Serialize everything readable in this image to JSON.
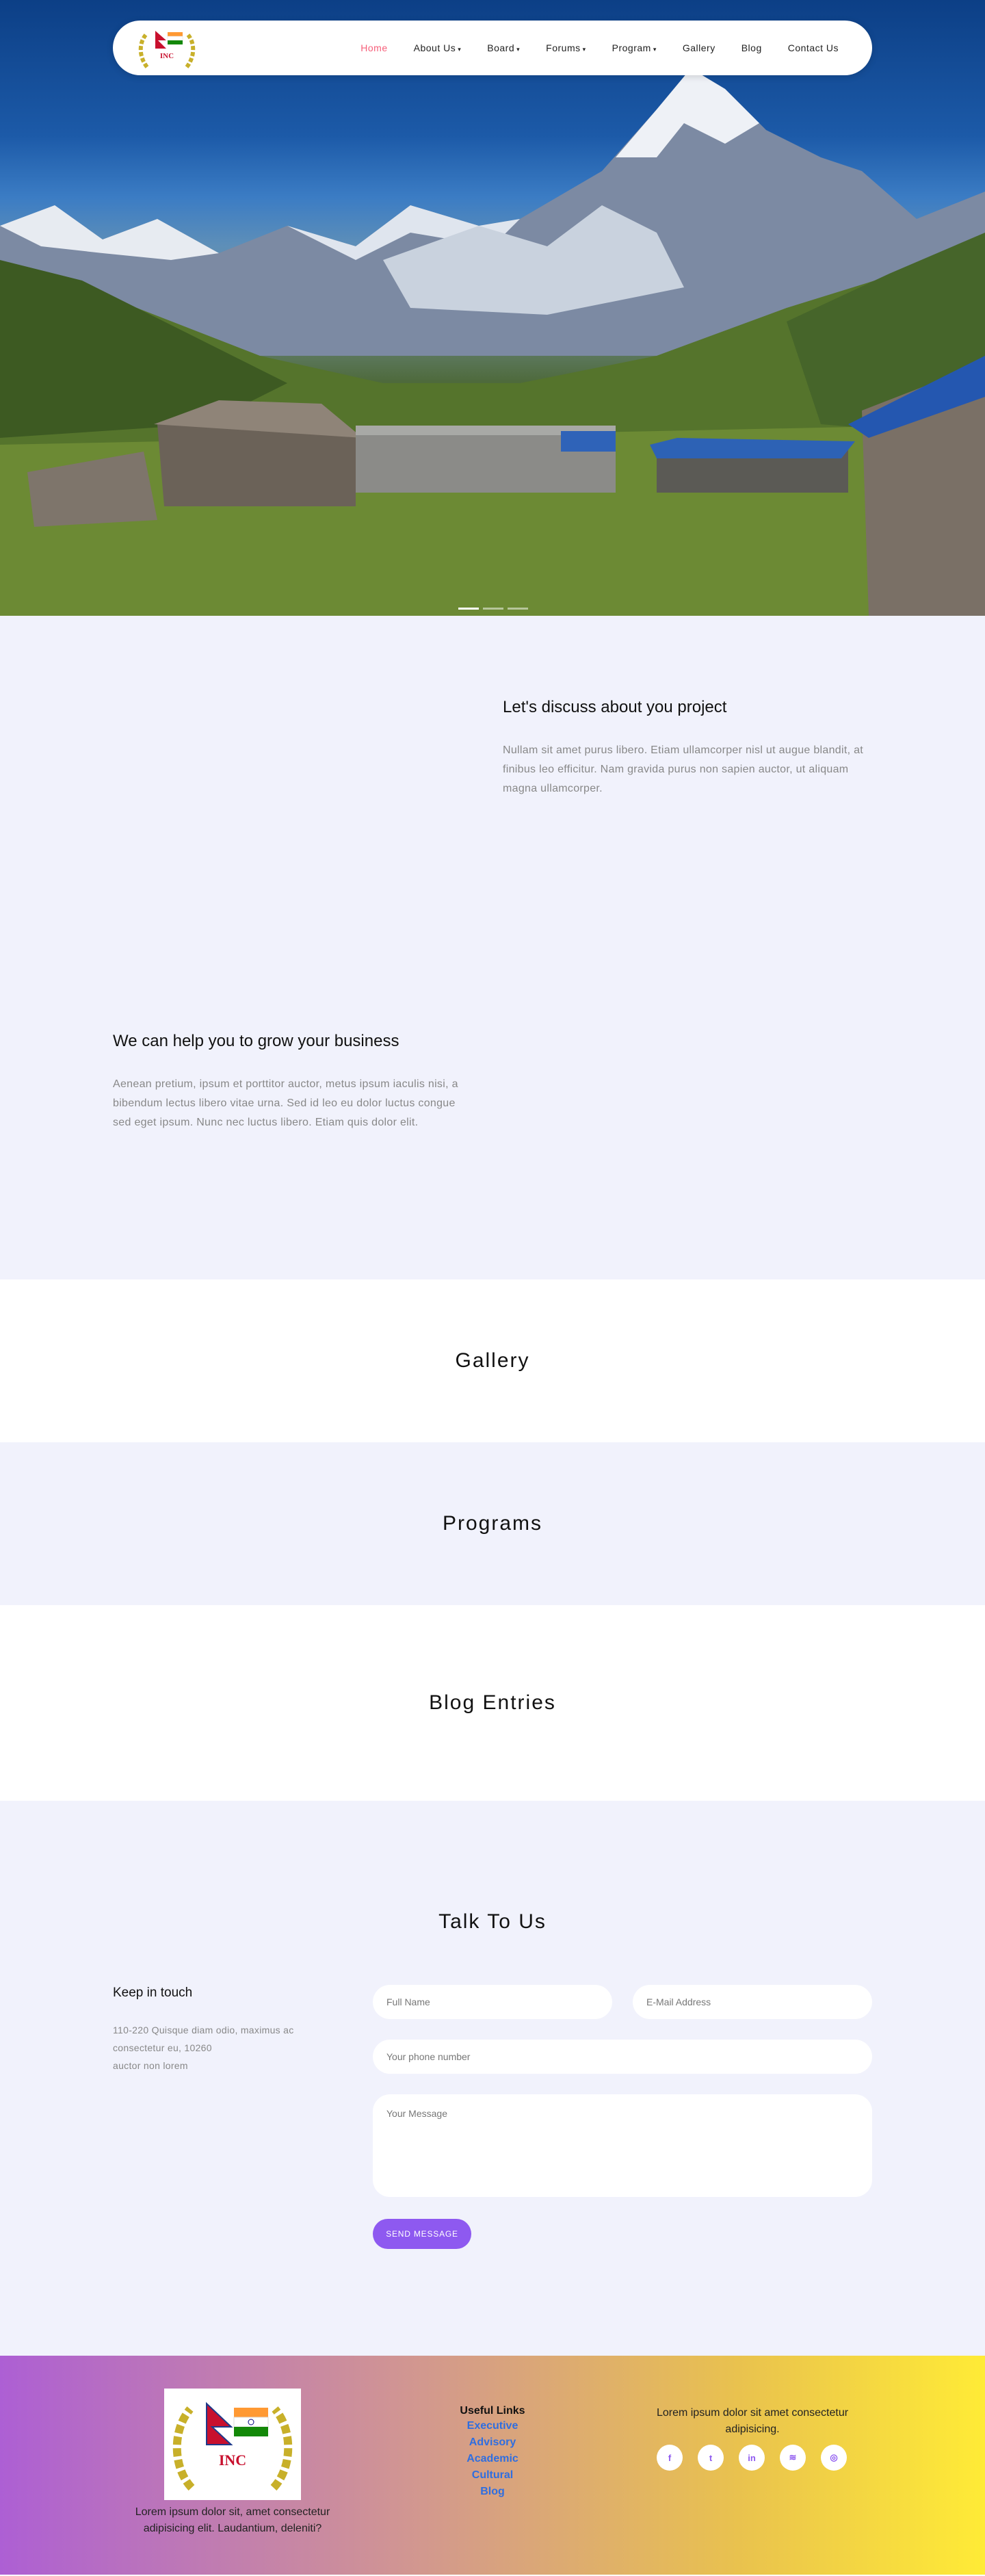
{
  "nav": {
    "items": [
      {
        "label": "Home",
        "active": true,
        "dropdown": false
      },
      {
        "label": "About Us",
        "active": false,
        "dropdown": true
      },
      {
        "label": "Board",
        "active": false,
        "dropdown": true
      },
      {
        "label": "Forums",
        "active": false,
        "dropdown": true
      },
      {
        "label": "Program",
        "active": false,
        "dropdown": true
      },
      {
        "label": "Gallery",
        "active": false,
        "dropdown": false
      },
      {
        "label": "Blog",
        "active": false,
        "dropdown": false
      },
      {
        "label": "Contact Us",
        "active": false,
        "dropdown": false
      }
    ],
    "logo_text": "INC",
    "active_color": "#f65f7a"
  },
  "hero": {
    "slides": 3,
    "active_slide": 1
  },
  "features": [
    {
      "title": "Let's discuss about you project",
      "text": "Nullam sit amet purus libero. Etiam ullamcorper nisl ut augue blandit, at finibus leo efficitur. Nam gravida purus non sapien auctor, ut aliquam magna ullamcorper."
    },
    {
      "title": "We can help you to grow your business",
      "text": "Aenean pretium, ipsum et porttitor auctor, metus ipsum iaculis nisi, a bibendum lectus libero vitae urna. Sed id leo eu dolor luctus congue sed eget ipsum. Nunc nec luctus libero. Etiam quis dolor elit."
    }
  ],
  "sections": {
    "gallery": "Gallery",
    "programs": "Programs",
    "blog": "Blog Entries"
  },
  "contact": {
    "title": "Talk To Us",
    "keep_title": "Keep in touch",
    "address_line1": "110-220 Quisque diam odio, maximus ac consectetur eu, 10260",
    "address_line2": "auctor non lorem",
    "name_placeholder": "Full Name",
    "email_placeholder": "E-Mail Address",
    "phone_placeholder": "Your phone number",
    "message_placeholder": "Your Message",
    "send_label": "SEND MESSAGE",
    "accent": "#8e59f0"
  },
  "footer": {
    "logo_text": "INC",
    "logo_caption": "Lorem ipsum dolor sit, amet consectetur adipisicing elit. Laudantium, deleniti?",
    "links_title": "Useful Links",
    "links": [
      "Executive",
      "Advisory",
      "Academic",
      "Cultural",
      "Blog"
    ],
    "about": "Lorem ipsum dolor sit amet consectetur adipisicing.",
    "social": [
      {
        "icon": "facebook-icon",
        "glyph": "f"
      },
      {
        "icon": "twitter-icon",
        "glyph": "t"
      },
      {
        "icon": "linkedin-icon",
        "glyph": "in"
      },
      {
        "icon": "rss-icon",
        "glyph": "≋"
      },
      {
        "icon": "dribbble-icon",
        "glyph": "◎"
      }
    ],
    "link_color": "#2f6ee0"
  }
}
